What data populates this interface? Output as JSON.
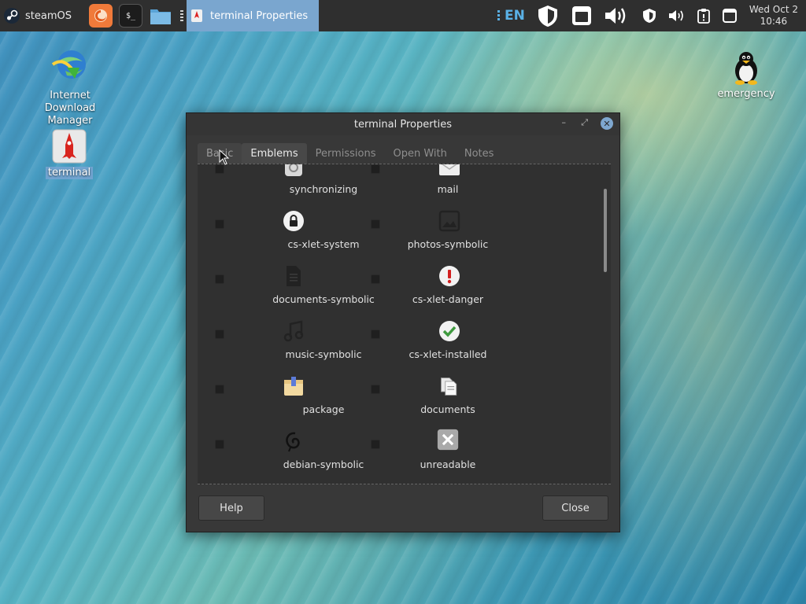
{
  "panel": {
    "menu_label": "steamOS",
    "task_title": "terminal Properties",
    "language": "EN",
    "clock_day": "Wed Oct  2",
    "clock_time": "10:46",
    "launchers": [
      "firefox-icon",
      "terminal-icon",
      "files-icon"
    ],
    "tray_icons": [
      "shield-icon",
      "window-icon",
      "volume-icon",
      "shield-small-icon",
      "volume-small-icon",
      "clipboard-icon",
      "window-small-icon"
    ]
  },
  "desktop": {
    "icons": [
      {
        "label": "Internet Download Manager",
        "icon": "idm-icon"
      },
      {
        "label": "terminal",
        "icon": "terminal-launcher-icon",
        "selected": true
      },
      {
        "label": "emergency",
        "icon": "tux-icon"
      }
    ]
  },
  "dialog": {
    "title": "terminal Properties",
    "tabs": [
      "Basic",
      "Emblems",
      "Permissions",
      "Open With",
      "Notes"
    ],
    "active_tab": "Emblems",
    "emblems": [
      {
        "label": "synchronizing",
        "icon": "sync-icon",
        "checked": false
      },
      {
        "label": "mail",
        "icon": "mail-icon",
        "checked": false
      },
      {
        "label": "cs-xlet-system",
        "icon": "lock-icon",
        "checked": false
      },
      {
        "label": "photos-symbolic",
        "icon": "photos-icon",
        "checked": false
      },
      {
        "label": "documents-symbolic",
        "icon": "document-icon",
        "checked": false
      },
      {
        "label": "cs-xlet-danger",
        "icon": "danger-icon",
        "checked": false
      },
      {
        "label": "music-symbolic",
        "icon": "music-icon",
        "checked": false
      },
      {
        "label": "cs-xlet-installed",
        "icon": "installed-check-icon",
        "checked": false
      },
      {
        "label": "package",
        "icon": "package-icon",
        "checked": false
      },
      {
        "label": "documents",
        "icon": "documents-icon",
        "checked": false
      },
      {
        "label": "debian-symbolic",
        "icon": "debian-icon",
        "checked": false
      },
      {
        "label": "unreadable",
        "icon": "unreadable-icon",
        "checked": false
      }
    ],
    "help_label": "Help",
    "close_label": "Close"
  }
}
